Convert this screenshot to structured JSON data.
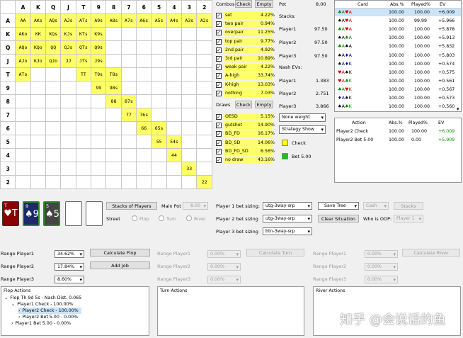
{
  "grid": {
    "headers": [
      "A",
      "K",
      "Q",
      "J",
      "T",
      "9",
      "8",
      "7",
      "6",
      "5",
      "4",
      "3",
      "2"
    ],
    "rows": [
      {
        "label": "A",
        "cells": [
          [
            "AA",
            1
          ],
          [
            "AKs",
            1
          ],
          [
            "AQs",
            1
          ],
          [
            "AJs",
            1
          ],
          [
            "ATs",
            1
          ],
          [
            "A9s",
            1
          ],
          [
            "A8s",
            1
          ],
          [
            "A7s",
            1
          ],
          [
            "A6s",
            1
          ],
          [
            "A5s",
            1
          ],
          [
            "A4s",
            1
          ],
          [
            "A3s",
            1
          ],
          [
            "A2s",
            1
          ]
        ]
      },
      {
        "label": "K",
        "cells": [
          [
            "AKo",
            1
          ],
          [
            "KK",
            1
          ],
          [
            "KQs",
            1
          ],
          [
            "KJs",
            1
          ],
          [
            "KTs",
            1
          ],
          [
            "K9s",
            1
          ],
          [
            "",
            0
          ],
          [
            "",
            0
          ],
          [
            "",
            0
          ],
          [
            "",
            0
          ],
          [
            "",
            0
          ],
          [
            "",
            0
          ],
          [
            "",
            0
          ]
        ]
      },
      {
        "label": "Q",
        "cells": [
          [
            "AQo",
            1
          ],
          [
            "KQo",
            1
          ],
          [
            "QQ",
            1
          ],
          [
            "QJs",
            1
          ],
          [
            "QTs",
            1
          ],
          [
            "Q9s",
            1
          ],
          [
            "",
            0
          ],
          [
            "",
            0
          ],
          [
            "",
            0
          ],
          [
            "",
            0
          ],
          [
            "",
            0
          ],
          [
            "",
            0
          ],
          [
            "",
            0
          ]
        ]
      },
      {
        "label": "J",
        "cells": [
          [
            "AJo",
            1
          ],
          [
            "KJo",
            1
          ],
          [
            "QJo",
            1
          ],
          [
            "JJ",
            1
          ],
          [
            "JTs",
            1
          ],
          [
            "J9s",
            1
          ],
          [
            "",
            0
          ],
          [
            "",
            0
          ],
          [
            "",
            0
          ],
          [
            "",
            0
          ],
          [
            "",
            0
          ],
          [
            "",
            0
          ],
          [
            "",
            0
          ]
        ]
      },
      {
        "label": "T",
        "cells": [
          [
            "ATo",
            1
          ],
          [
            "",
            0
          ],
          [
            "",
            0
          ],
          [
            "",
            0
          ],
          [
            "TT",
            1
          ],
          [
            "T9s",
            1
          ],
          [
            "T8s",
            1
          ],
          [
            "",
            0
          ],
          [
            "",
            0
          ],
          [
            "",
            0
          ],
          [
            "",
            0
          ],
          [
            "",
            0
          ],
          [
            "",
            0
          ]
        ]
      },
      {
        "label": "9",
        "cells": [
          [
            "",
            0
          ],
          [
            "",
            0
          ],
          [
            "",
            0
          ],
          [
            "",
            0
          ],
          [
            "",
            0
          ],
          [
            "99",
            1
          ],
          [
            "98s",
            1
          ],
          [
            "",
            0
          ],
          [
            "",
            0
          ],
          [
            "",
            0
          ],
          [
            "",
            0
          ],
          [
            "",
            0
          ],
          [
            "",
            0
          ]
        ]
      },
      {
        "label": "8",
        "cells": [
          [
            "",
            0
          ],
          [
            "",
            0
          ],
          [
            "",
            0
          ],
          [
            "",
            0
          ],
          [
            "",
            0
          ],
          [
            "",
            0
          ],
          [
            "88",
            1
          ],
          [
            "87s",
            1
          ],
          [
            "",
            0
          ],
          [
            "",
            0
          ],
          [
            "",
            0
          ],
          [
            "",
            0
          ],
          [
            "",
            0
          ]
        ]
      },
      {
        "label": "7",
        "cells": [
          [
            "",
            0
          ],
          [
            "",
            0
          ],
          [
            "",
            0
          ],
          [
            "",
            0
          ],
          [
            "",
            0
          ],
          [
            "",
            0
          ],
          [
            "",
            0
          ],
          [
            "77",
            1
          ],
          [
            "76s",
            1
          ],
          [
            "",
            0
          ],
          [
            "",
            0
          ],
          [
            "",
            0
          ],
          [
            "",
            0
          ]
        ]
      },
      {
        "label": "6",
        "cells": [
          [
            "",
            0
          ],
          [
            "",
            0
          ],
          [
            "",
            0
          ],
          [
            "",
            0
          ],
          [
            "",
            0
          ],
          [
            "",
            0
          ],
          [
            "",
            0
          ],
          [
            "",
            0
          ],
          [
            "66",
            1
          ],
          [
            "65s",
            1
          ],
          [
            "",
            0
          ],
          [
            "",
            0
          ],
          [
            "",
            0
          ]
        ]
      },
      {
        "label": "5",
        "cells": [
          [
            "",
            0
          ],
          [
            "",
            0
          ],
          [
            "",
            0
          ],
          [
            "",
            0
          ],
          [
            "",
            0
          ],
          [
            "",
            0
          ],
          [
            "",
            0
          ],
          [
            "",
            0
          ],
          [
            "",
            0
          ],
          [
            "55",
            1
          ],
          [
            "54s",
            1
          ],
          [
            "",
            0
          ],
          [
            "",
            0
          ]
        ]
      },
      {
        "label": "4",
        "cells": [
          [
            "",
            0
          ],
          [
            "",
            0
          ],
          [
            "",
            0
          ],
          [
            "",
            0
          ],
          [
            "",
            0
          ],
          [
            "",
            0
          ],
          [
            "",
            0
          ],
          [
            "",
            0
          ],
          [
            "",
            0
          ],
          [
            "",
            0
          ],
          [
            "44",
            1
          ],
          [
            "",
            0
          ],
          [
            "",
            0
          ]
        ]
      },
      {
        "label": "3",
        "cells": [
          [
            "",
            0
          ],
          [
            "",
            0
          ],
          [
            "",
            0
          ],
          [
            "",
            0
          ],
          [
            "",
            0
          ],
          [
            "",
            0
          ],
          [
            "",
            0
          ],
          [
            "",
            0
          ],
          [
            "",
            0
          ],
          [
            "",
            0
          ],
          [
            "",
            0
          ],
          [
            "33",
            1
          ],
          [
            "",
            0
          ]
        ]
      },
      {
        "label": "2",
        "cells": [
          [
            "",
            0
          ],
          [
            "",
            0
          ],
          [
            "",
            0
          ],
          [
            "",
            0
          ],
          [
            "",
            0
          ],
          [
            "",
            0
          ],
          [
            "",
            0
          ],
          [
            "",
            0
          ],
          [
            "",
            0
          ],
          [
            "",
            0
          ],
          [
            "",
            0
          ],
          [
            "",
            0
          ],
          [
            "22",
            1
          ]
        ]
      }
    ]
  },
  "combos": {
    "title": "Combos",
    "check_label": "Check",
    "empty_label": "Empty",
    "items": [
      {
        "name": "set",
        "value": "4.22%"
      },
      {
        "name": "two pair",
        "value": "0.94%"
      },
      {
        "name": "overpair",
        "value": "11.25%"
      },
      {
        "name": "top pair",
        "value": "9.77%"
      },
      {
        "name": "2nd pair",
        "value": "4.92%"
      },
      {
        "name": "3rd pair",
        "value": "10.89%"
      },
      {
        "name": "weak pair",
        "value": "4.22%"
      },
      {
        "name": "A-high",
        "value": "33.74%"
      },
      {
        "name": "K-high",
        "value": "13.03%"
      },
      {
        "name": "nothing",
        "value": "7.03%"
      }
    ]
  },
  "draws": {
    "title": "Draws",
    "check_label": "Check",
    "empty_label": "Empty",
    "items": [
      {
        "name": "OESD",
        "value": "5.15%"
      },
      {
        "name": "gutshot",
        "value": "14.90%"
      },
      {
        "name": "BD_FD",
        "value": "16.17%"
      },
      {
        "name": "BD_SD",
        "value": "14.06%"
      },
      {
        "name": "BD_FD_SD",
        "value": "6.56%"
      },
      {
        "name": "no draw",
        "value": "43.16%"
      }
    ]
  },
  "pot": {
    "pot_label": "Pot",
    "pot_value": "8.00",
    "stacks_label": "Stacks:",
    "stacks": [
      {
        "name": "Player1",
        "value": "97.50"
      },
      {
        "name": "Player2",
        "value": "97.50"
      },
      {
        "name": "Player3",
        "value": "97.50"
      }
    ],
    "ev_label": "Nash EVs:",
    "evs": [
      {
        "name": "Player1",
        "value": "1.383"
      },
      {
        "name": "Player2",
        "value": "2.751"
      },
      {
        "name": "Player3",
        "value": "3.866"
      }
    ],
    "weight_select": "None weight",
    "strategy_select": "Strategy Show",
    "legend": [
      {
        "label": "Check",
        "color": "#ffff00"
      },
      {
        "label": "Bet 5.00",
        "color": "#22bb22"
      }
    ]
  },
  "card_table": {
    "headers": [
      "Card",
      "Abs.%",
      "Played%",
      "EV"
    ],
    "rows": [
      {
        "c1": "♣A",
        "c1col": "grn",
        "c2": "♥A",
        "c2col": "red",
        "abs": "100.00",
        "played": "100.00",
        "ev": "+6.009"
      },
      {
        "c1": "♠A",
        "c1col": "blk",
        "c2": "♥A",
        "c2col": "red",
        "abs": "100.00",
        "played": "99.99",
        "ev": "+5.966"
      },
      {
        "c1": "♣A",
        "c1col": "grn",
        "c2": "♥A",
        "c2col": "red",
        "abs": "100.00",
        "played": "100.00",
        "ev": "+5.878"
      },
      {
        "c1": "♠A",
        "c1col": "blk",
        "c2": "♣A",
        "c2col": "grn",
        "abs": "100.00",
        "played": "100.00",
        "ev": "+5.913"
      },
      {
        "c1": "♣A",
        "c1col": "grn",
        "c2": "♠A",
        "c2col": "blk",
        "abs": "100.00",
        "played": "100.00",
        "ev": "+5.832"
      },
      {
        "c1": "♠A",
        "c1col": "blk",
        "c2": "♦A",
        "c2col": "blu",
        "abs": "100.00",
        "played": "100.00",
        "ev": "+5.803"
      },
      {
        "c1": "♠A",
        "c1col": "blk",
        "c2": "♦K",
        "c2col": "blu",
        "abs": "100.00",
        "played": "100.00",
        "ev": "+0.574"
      },
      {
        "c1": "♥A",
        "c1col": "red",
        "c2": "♠K",
        "c2col": "blk",
        "abs": "100.00",
        "played": "100.00",
        "ev": "+0.575"
      },
      {
        "c1": "♥A",
        "c1col": "red",
        "c2": "♣K",
        "c2col": "grn",
        "abs": "100.00",
        "played": "100.00",
        "ev": "+0.561"
      },
      {
        "c1": "♣A",
        "c1col": "grn",
        "c2": "♥K",
        "c2col": "red",
        "abs": "100.00",
        "played": "100.00",
        "ev": "+0.567"
      },
      {
        "c1": "♦A",
        "c1col": "blu",
        "c2": "♠K",
        "c2col": "blk",
        "abs": "100.00",
        "played": "100.00",
        "ev": "+0.573"
      },
      {
        "c1": "♠A",
        "c1col": "blk",
        "c2": "♣K",
        "c2col": "grn",
        "abs": "100.00",
        "played": "100.00",
        "ev": "+0.560"
      }
    ]
  },
  "action_table": {
    "headers": [
      "Action",
      "Abs.%",
      "Played%",
      "EV"
    ],
    "rows": [
      {
        "action": "Player2 Check",
        "abs": "100.00",
        "played": "100.00",
        "ev": "+6.009",
        "evcol": "#080"
      },
      {
        "action": "Player2 Bet 5.00",
        "abs": "100.00",
        "played": "0.00",
        "ev": "+5.909",
        "evcol": "#080"
      }
    ]
  },
  "board": {
    "cards": [
      {
        "rank": "T",
        "big": "♥T",
        "bg": "#8b0000",
        "border": "#333"
      },
      {
        "rank": "9",
        "big": "♠9",
        "bg": "#1a2a6c",
        "border": "#2a8a2a"
      },
      {
        "rank": "5",
        "big": "♠5",
        "bg": "#444444",
        "border": "#2a8a2a"
      }
    ]
  },
  "controls": {
    "stacks_btn": "Stacks of Players",
    "main_pot_label": "Main Pot",
    "main_pot_value": "8.00",
    "street_label": "Street",
    "streets": [
      "Flop",
      "Turn",
      "River"
    ],
    "p1_bet_label": "Player 1 bet sizing:",
    "p1_bet_value": "utg-3way-srp",
    "p2_bet_label": "Player 2 bet sizing",
    "p2_bet_value": "utg-3way-srp",
    "p3_bet_label": "Player 3 bet sizing",
    "p3_bet_value": "btn-3way-srp",
    "save_tree": "Save Tree",
    "clear_situation": "Clear Situation",
    "cash_value": "Cash",
    "stacks_small": "Stacks",
    "oop_label": "Who is OOP:",
    "oop_value": "Player 1"
  },
  "ranges_flop": {
    "rows": [
      {
        "label": "Range Player1",
        "value": "34.62%"
      },
      {
        "label": "Range Player2",
        "value": "17.84%"
      },
      {
        "label": "Range Player3",
        "value": "8.60%"
      }
    ],
    "calc_btn": "Calculate Flop",
    "add_job_btn": "Add Job"
  },
  "ranges_turn": {
    "rows": [
      {
        "label": "Range Player1",
        "value": "0.00%"
      },
      {
        "label": "Range Player2",
        "value": "0.00%"
      },
      {
        "label": "Range Player3",
        "value": "0.00%"
      }
    ],
    "calc_btn": "Calculate Turn"
  },
  "ranges_river": {
    "rows": [
      {
        "label": "Range Player1",
        "value": "0.00%"
      },
      {
        "label": "Range Player2",
        "value": "0.00%"
      },
      {
        "label": "Range Player3",
        "value": "0.00%"
      }
    ],
    "calc_btn": "Calculate River"
  },
  "flop_actions": {
    "title": "Flop Actions",
    "tree": [
      {
        "indent": 0,
        "arrow": "⌄",
        "text": "Flop Th 9d 5s - Nash Dist. 0.065",
        "sel": false
      },
      {
        "indent": 1,
        "arrow": "⌄",
        "text": "Player1 Check - 100.00%",
        "sel": false
      },
      {
        "indent": 2,
        "arrow": "›",
        "text": "Player2 Check - 100.00%",
        "sel": true
      },
      {
        "indent": 2,
        "arrow": "›",
        "text": "Player2 Bet 5.00 - 0.00%",
        "sel": false
      },
      {
        "indent": 1,
        "arrow": "›",
        "text": "Player1 Bet 5.00 - 0.00%",
        "sel": false
      }
    ]
  },
  "turn_actions": {
    "title": "Turn Actions"
  },
  "river_actions": {
    "title": "River Actions"
  },
  "watermark": "知乎 @会说话的鱼"
}
